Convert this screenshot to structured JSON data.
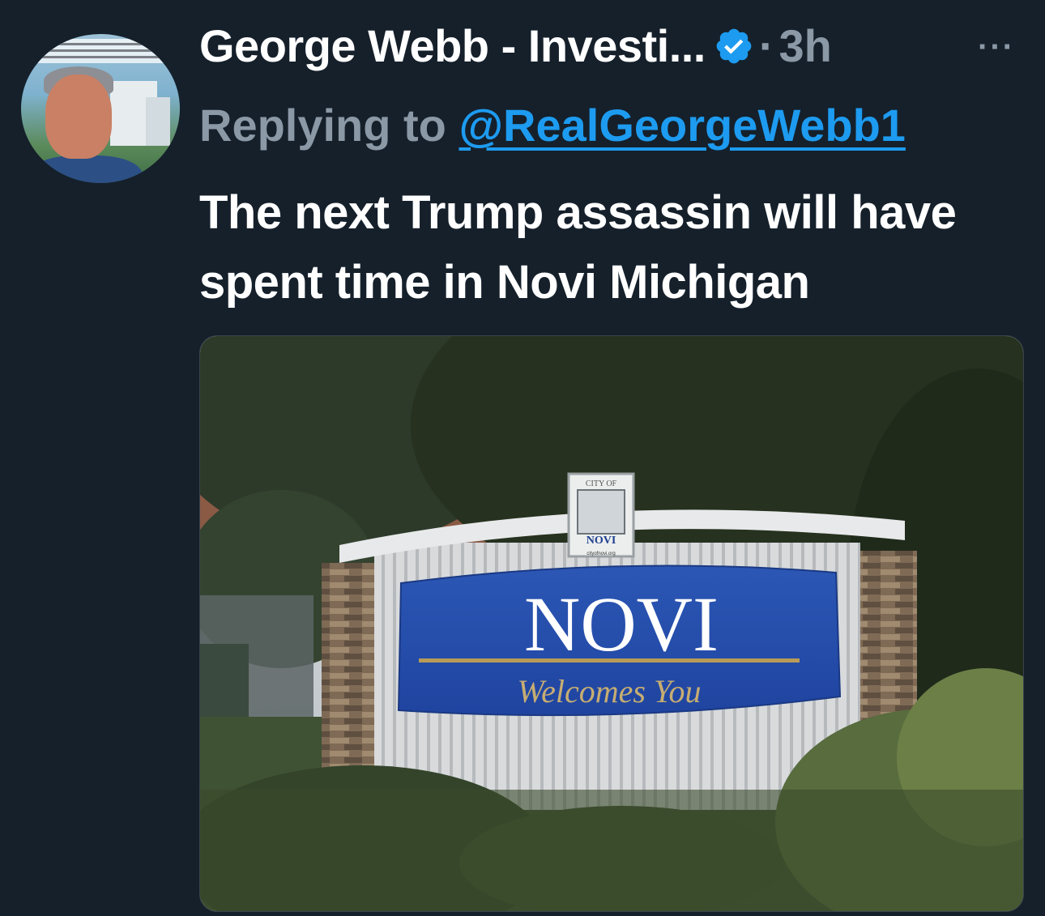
{
  "tweet": {
    "display_name": "George Webb - Investi...",
    "separator": "·",
    "timestamp": "3h",
    "more_label": "···",
    "reply_label": "Replying to ",
    "reply_handle": "@RealGeorgeWebb1",
    "text": "The next Trump assassin will have spent time in Novi Michigan",
    "verified": true,
    "colors": {
      "background": "#15202b",
      "muted": "#8b98a5",
      "link": "#1d9bf0",
      "verified_badge": "#1d9bf0"
    }
  },
  "media": {
    "sign_title": "NOVI",
    "sign_subtitle": "Welcomes You",
    "plaque_top": "CITY OF",
    "plaque_name": "NOVI",
    "plaque_url": "cityofnovi.org"
  }
}
